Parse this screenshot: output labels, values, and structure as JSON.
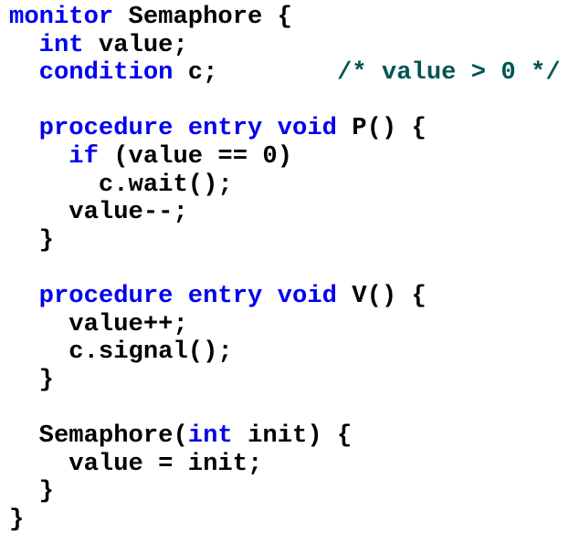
{
  "colors": {
    "keyword": "#0000ee",
    "comment": "#005555",
    "text": "#000000",
    "background": "#ffffff"
  },
  "code": {
    "lines": [
      [
        {
          "t": "kw",
          "v": "monitor"
        },
        {
          "t": "tx",
          "v": " Semaphore {"
        }
      ],
      [
        {
          "t": "tx",
          "v": "  "
        },
        {
          "t": "kw",
          "v": "int"
        },
        {
          "t": "tx",
          "v": " value;"
        }
      ],
      [
        {
          "t": "tx",
          "v": "  "
        },
        {
          "t": "kw",
          "v": "condition"
        },
        {
          "t": "tx",
          "v": " c;        "
        },
        {
          "t": "cm",
          "v": "/* value > 0 */"
        }
      ],
      [],
      [
        {
          "t": "tx",
          "v": "  "
        },
        {
          "t": "kw",
          "v": "procedure entry void"
        },
        {
          "t": "tx",
          "v": " P() {"
        }
      ],
      [
        {
          "t": "tx",
          "v": "    "
        },
        {
          "t": "kw",
          "v": "if"
        },
        {
          "t": "tx",
          "v": " (value == 0)"
        }
      ],
      [
        {
          "t": "tx",
          "v": "      c.wait();"
        }
      ],
      [
        {
          "t": "tx",
          "v": "    value--;"
        }
      ],
      [
        {
          "t": "tx",
          "v": "  }"
        }
      ],
      [],
      [
        {
          "t": "tx",
          "v": "  "
        },
        {
          "t": "kw",
          "v": "procedure entry void"
        },
        {
          "t": "tx",
          "v": " V() {"
        }
      ],
      [
        {
          "t": "tx",
          "v": "    value++;"
        }
      ],
      [
        {
          "t": "tx",
          "v": "    c.signal();"
        }
      ],
      [
        {
          "t": "tx",
          "v": "  }"
        }
      ],
      [],
      [
        {
          "t": "tx",
          "v": "  Semaphore("
        },
        {
          "t": "kw",
          "v": "int"
        },
        {
          "t": "tx",
          "v": " init) {"
        }
      ],
      [
        {
          "t": "tx",
          "v": "    value = init;"
        }
      ],
      [
        {
          "t": "tx",
          "v": "  }"
        }
      ],
      [
        {
          "t": "tx",
          "v": "}"
        }
      ]
    ]
  }
}
